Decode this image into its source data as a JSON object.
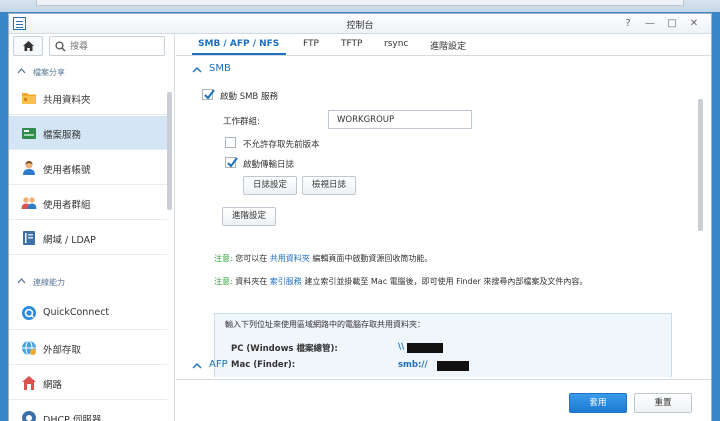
{
  "window": {
    "title": "控制台",
    "help": "?",
    "minimize": "—",
    "maximize": "□",
    "close": "✕"
  },
  "sidebar": {
    "search_placeholder": "搜尋",
    "sections": [
      {
        "label": "檔案分享"
      },
      {
        "label": "連線能力"
      }
    ],
    "items": [
      {
        "label": "共用資料夾",
        "icon": "shared-folder-icon"
      },
      {
        "label": "檔案服務",
        "icon": "file-services-icon",
        "active": true
      },
      {
        "label": "使用者帳號",
        "icon": "user-icon"
      },
      {
        "label": "使用者群組",
        "icon": "group-icon"
      },
      {
        "label": "網域 / LDAP",
        "icon": "domain-ldap-icon"
      },
      {
        "label": "QuickConnect",
        "icon": "quickconnect-icon"
      },
      {
        "label": "外部存取",
        "icon": "external-access-icon"
      },
      {
        "label": "網路",
        "icon": "network-icon"
      },
      {
        "label": "DHCP 伺服器",
        "icon": "dhcp-server-icon"
      }
    ]
  },
  "tabs": [
    {
      "label": "SMB / AFP / NFS",
      "active": true
    },
    {
      "label": "FTP"
    },
    {
      "label": "TFTP"
    },
    {
      "label": "rsync"
    },
    {
      "label": "進階設定"
    }
  ],
  "smb": {
    "header": "SMB",
    "enable_label": "啟動 SMB 服務",
    "workgroup_label": "工作群組:",
    "workgroup_value": "WORKGROUP",
    "disallow_prev_label": "不允許存取先前版本",
    "enable_log_label": "啟動傳輸日誌",
    "log_settings_button": "日誌設定",
    "view_log_button": "檢視日誌",
    "advanced_button": "進階設定",
    "note1": {
      "label": "注意:",
      "pre": "您可以在",
      "link": "共用資料夾",
      "post": "編輯頁面中啟動資源回收筒功能。"
    },
    "note2": {
      "label": "注意:",
      "pre": "資料夾在",
      "link": "索引服務",
      "post": "建立索引並掛載至 Mac 電腦後，即可使用 Finder 來搜尋內部檔案及文件內容。"
    },
    "access_caption": "輸入下列位址來使用區域網路中的電腦存取共用資料夾：",
    "pc_label": "PC (Windows 檔案總管):",
    "pc_value": "\\\\",
    "mac_label": "Mac (Finder):",
    "mac_value": "smb://"
  },
  "afp": {
    "header": "AFP"
  },
  "footer": {
    "apply_label": "套用",
    "reset_label": "重置"
  },
  "colors": {
    "accent": "#1d6fc0",
    "note_green": "#2e9b38",
    "active_bg": "#d4e6f6",
    "primary_button": "#2a8be0"
  }
}
